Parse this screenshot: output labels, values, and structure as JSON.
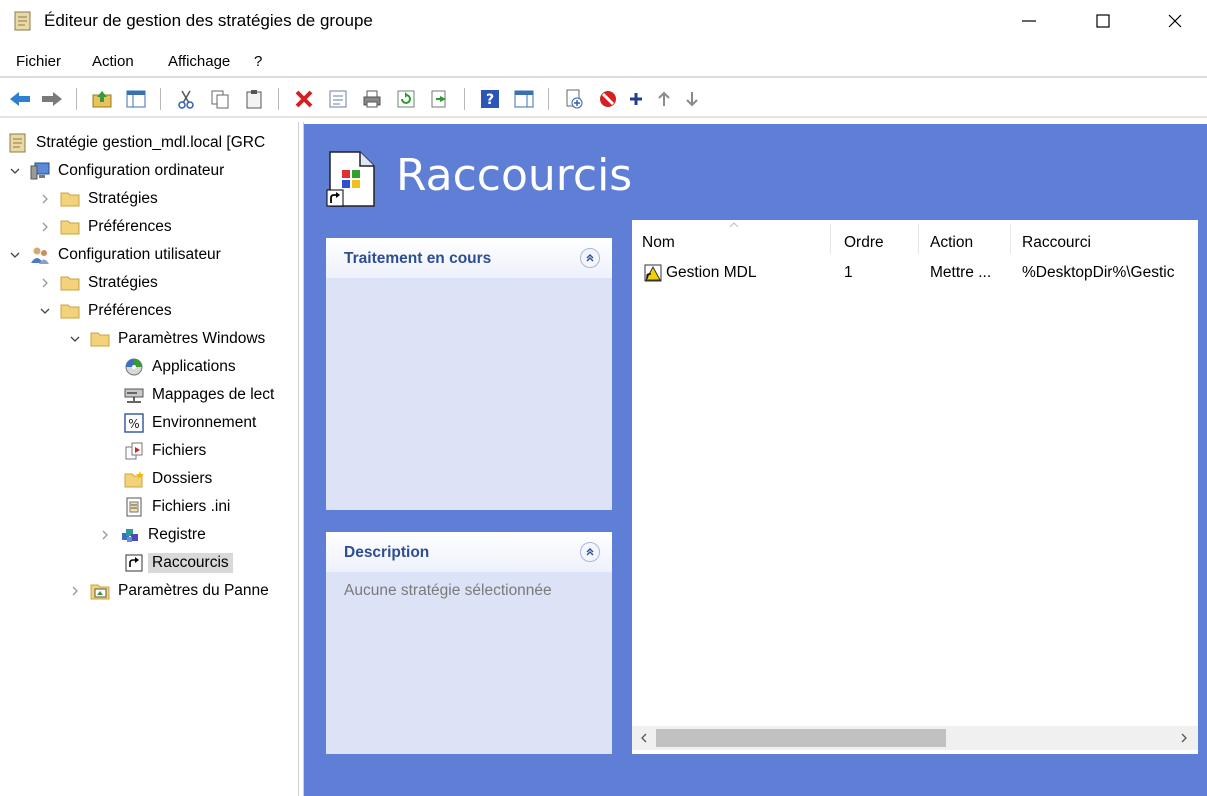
{
  "window": {
    "title": "Éditeur de gestion des stratégies de groupe",
    "minimize_icon": "minimize-icon",
    "maximize_icon": "maximize-icon",
    "close_icon": "close-icon"
  },
  "menu": {
    "items": [
      "Fichier",
      "Action",
      "Affichage",
      "?"
    ]
  },
  "toolbar": {
    "icons": [
      "back-arrow-icon",
      "forward-arrow-icon",
      "up-folder-icon",
      "show-hide-tree-icon",
      "cut-icon",
      "copy-icon",
      "paste-icon",
      "delete-icon",
      "properties-icon",
      "print-icon",
      "refresh-icon",
      "export-icon",
      "help-icon",
      "action-pane-icon",
      "new-item-icon",
      "disable-icon",
      "add-icon",
      "move-up-icon",
      "move-down-icon"
    ]
  },
  "tree": {
    "items": [
      {
        "label": "Stratégie gestion_mdl.local [GRC",
        "icon": "policy-icon",
        "expander": "none"
      },
      {
        "label": "Configuration ordinateur",
        "icon": "computer-icon",
        "expander": "expanded"
      },
      {
        "label": "Stratégies",
        "icon": "folder-icon",
        "expander": "collapsed"
      },
      {
        "label": "Préférences",
        "icon": "folder-icon",
        "expander": "collapsed"
      },
      {
        "label": "Configuration utilisateur",
        "icon": "users-icon",
        "expander": "expanded"
      },
      {
        "label": "Stratégies",
        "icon": "folder-icon",
        "expander": "collapsed"
      },
      {
        "label": "Préférences",
        "icon": "folder-icon",
        "expander": "expanded"
      },
      {
        "label": "Paramètres Windows",
        "icon": "folder-icon",
        "expander": "expanded"
      },
      {
        "label": "Applications",
        "icon": "applications-icon",
        "expander": "none"
      },
      {
        "label": "Mappages de lect",
        "icon": "drive-map-icon",
        "expander": "none"
      },
      {
        "label": "Environnement",
        "icon": "environment-icon",
        "expander": "none"
      },
      {
        "label": "Fichiers",
        "icon": "files-icon",
        "expander": "none"
      },
      {
        "label": "Dossiers",
        "icon": "folders-icon",
        "expander": "none"
      },
      {
        "label": "Fichiers .ini",
        "icon": "ini-file-icon",
        "expander": "none"
      },
      {
        "label": "Registre",
        "icon": "registry-icon",
        "expander": "collapsed"
      },
      {
        "label": "Raccourcis",
        "icon": "shortcut-icon",
        "expander": "none"
      },
      {
        "label": "Paramètres du Panne",
        "icon": "control-panel-icon",
        "expander": "collapsed"
      }
    ],
    "selected": "Raccourcis"
  },
  "main": {
    "header_title": "Raccourcis",
    "header_icon": "shortcut-header-icon",
    "processing_panel": {
      "title": "Traitement en cours"
    },
    "description_panel": {
      "title": "Description",
      "text": "Aucune stratégie sélectionnée"
    },
    "list": {
      "columns": [
        "Nom",
        "Ordre",
        "Action",
        "Raccourci"
      ],
      "rows": [
        {
          "name": "Gestion MDL",
          "order": "1",
          "action": "Mettre ...",
          "target": "%DesktopDir%\\Gestic",
          "icon": "shortcut-item-icon"
        }
      ]
    }
  },
  "colors": {
    "pane_blue": "#5f7fd6",
    "panel_bg": "#dde3f6",
    "panel_title": "#2c4e93",
    "selection_gray": "#d9d9d9"
  }
}
